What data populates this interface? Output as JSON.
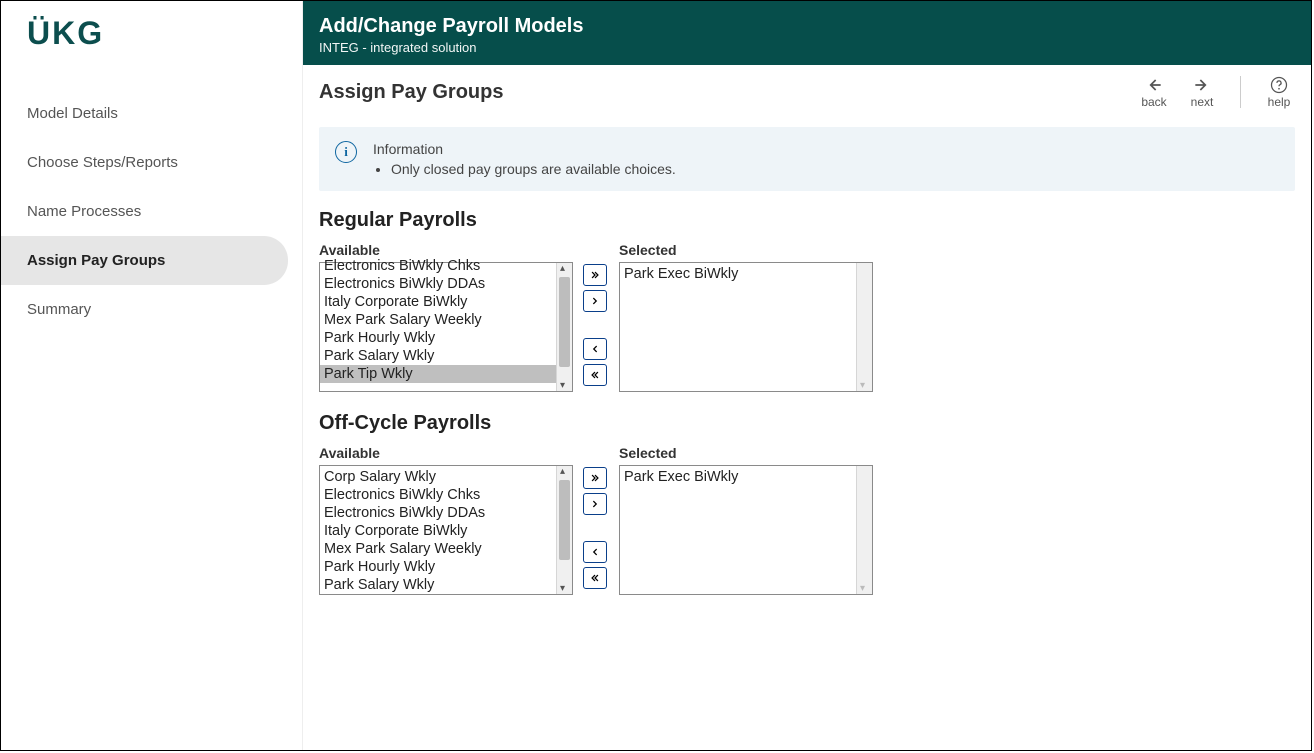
{
  "brand": "ÜKG",
  "banner": {
    "title": "Add/Change Payroll Models",
    "subtitle": "INTEG - integrated solution"
  },
  "nav": {
    "items": [
      {
        "key": "model-details",
        "label": "Model Details",
        "active": false
      },
      {
        "key": "choose-steps",
        "label": "Choose Steps/Reports",
        "active": false
      },
      {
        "key": "name-processes",
        "label": "Name Processes",
        "active": false
      },
      {
        "key": "assign-pay-groups",
        "label": "Assign Pay Groups",
        "active": true
      },
      {
        "key": "summary",
        "label": "Summary",
        "active": false
      }
    ]
  },
  "page": {
    "title": "Assign Pay Groups",
    "actions": {
      "back": "back",
      "next": "next",
      "help": "help"
    }
  },
  "info": {
    "heading": "Information",
    "bullets": [
      "Only closed pay groups are available choices."
    ]
  },
  "sections": {
    "regular": {
      "title": "Regular Payrolls",
      "availableLabel": "Available",
      "selectedLabel": "Selected",
      "available": [
        "Electronics BiWkly Chks",
        "Electronics BiWkly DDAs",
        "Italy Corporate BiWkly",
        "Mex Park Salary Weekly",
        "Park Hourly Wkly",
        "Park Salary Wkly",
        "Park Tip Wkly"
      ],
      "availableHighlighted": "Park Tip Wkly",
      "selected": [
        "Park Exec BiWkly"
      ]
    },
    "offcycle": {
      "title": "Off-Cycle Payrolls",
      "availableLabel": "Available",
      "selectedLabel": "Selected",
      "available": [
        "Corp Salary Wkly",
        "Electronics BiWkly Chks",
        "Electronics BiWkly DDAs",
        "Italy Corporate BiWkly",
        "Mex Park Salary Weekly",
        "Park Hourly Wkly",
        "Park Salary Wkly"
      ],
      "selected": [
        "Park Exec BiWkly"
      ]
    }
  }
}
